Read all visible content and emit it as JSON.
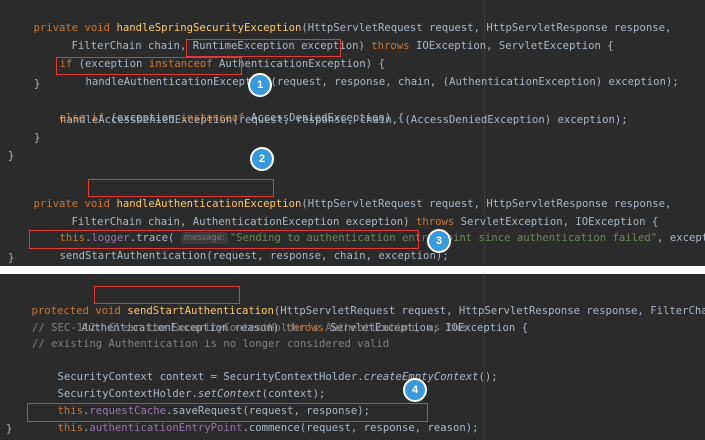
{
  "top_code": {
    "l1": {
      "kw1": "private void ",
      "fn": "handleSpringSecurityException",
      "rest": "(HttpServletRequest request, HttpServletResponse response,"
    },
    "l2": {
      "a": "FilterChain chain, RuntimeException exception) ",
      "kw": "throws",
      "b": " IOException, ServletException {"
    },
    "l3": {
      "kw1": "if",
      "a": " (exception ",
      "kw2": "instanceof",
      "sp": " ",
      "target": "AuthenticationException",
      "b": ") {"
    },
    "l4": {
      "target": "handleAuthenticationException",
      "rest": "(request, response, chain, (AuthenticationException) exception);"
    },
    "l5": {
      "text": "}"
    },
    "l6": {
      "kw1": "else if",
      "a": " (exception ",
      "kw2": "instanceof",
      "b": " AccessDeniedException) {"
    },
    "l7": {
      "text": "handleAccessDeniedException(request, response, chain, (AccessDeniedException) exception);"
    },
    "l8": {
      "text": "}"
    },
    "l9": {
      "text": "}"
    },
    "l11": {
      "kw1": "private void ",
      "fn": "handleAuthenticationException",
      "rest": "(HttpServletRequest request, HttpServletResponse response,"
    },
    "l12": {
      "a": "FilterChain chain, AuthenticationException exception) ",
      "kw": "throws",
      "b": " ServletException, IOException {"
    },
    "l13": {
      "kw_this": "this",
      "dot": ".",
      "fld": "logger",
      "a": ".trace( ",
      "hint": "message:",
      "str": "\"Sending to authentication entry point since authentication failed\"",
      "b": ", exception);"
    },
    "l14": {
      "text": "sendStartAuthentication(request, response, chain, exception);"
    },
    "l15": {
      "text": "}"
    }
  },
  "bottom_code": {
    "l1": {
      "kw1": "protected void ",
      "fn": "sendStartAuthentication",
      "rest": "(HttpServletRequest request, HttpServletResponse response, FilterChain chain,"
    },
    "l2": {
      "a": "AuthenticationException reason) ",
      "kw": "throws",
      "b": " ServletException, IOException {"
    },
    "l3": {
      "text": "// SEC-112: Clear the SecurityContextHolder's Authentication, as the"
    },
    "l4": {
      "text": "// existing Authentication is no longer considered valid"
    },
    "l5": {
      "a": "SecurityContext context = SecurityContextHolder.",
      "it": "createEmptyContext",
      "b": "();"
    },
    "l6": {
      "a": "SecurityContextHolder.",
      "it": "setContext",
      "b": "(context);"
    },
    "l7": {
      "kw_this": "this",
      "dot": ".",
      "fld": "requestCache",
      "b": ".saveRequest(request, response);"
    },
    "l8": {
      "kw_this": "this",
      "dot": ".",
      "fld": "authenticationEntryPoint",
      "b": ".commence(request, response, reason);"
    },
    "l9": {
      "text": "}"
    }
  },
  "badges": {
    "b1": "1",
    "b2": "2",
    "b3": "3",
    "b4": "4"
  },
  "colors": {
    "background": "#2b2b2b",
    "keyword": "#cc7832",
    "method_declaration": "#ffc66d",
    "field": "#9876aa",
    "string": "#6a8759",
    "comment": "#808080",
    "highlight_box": "#e03a3a",
    "badge": "#3a9ad9"
  }
}
